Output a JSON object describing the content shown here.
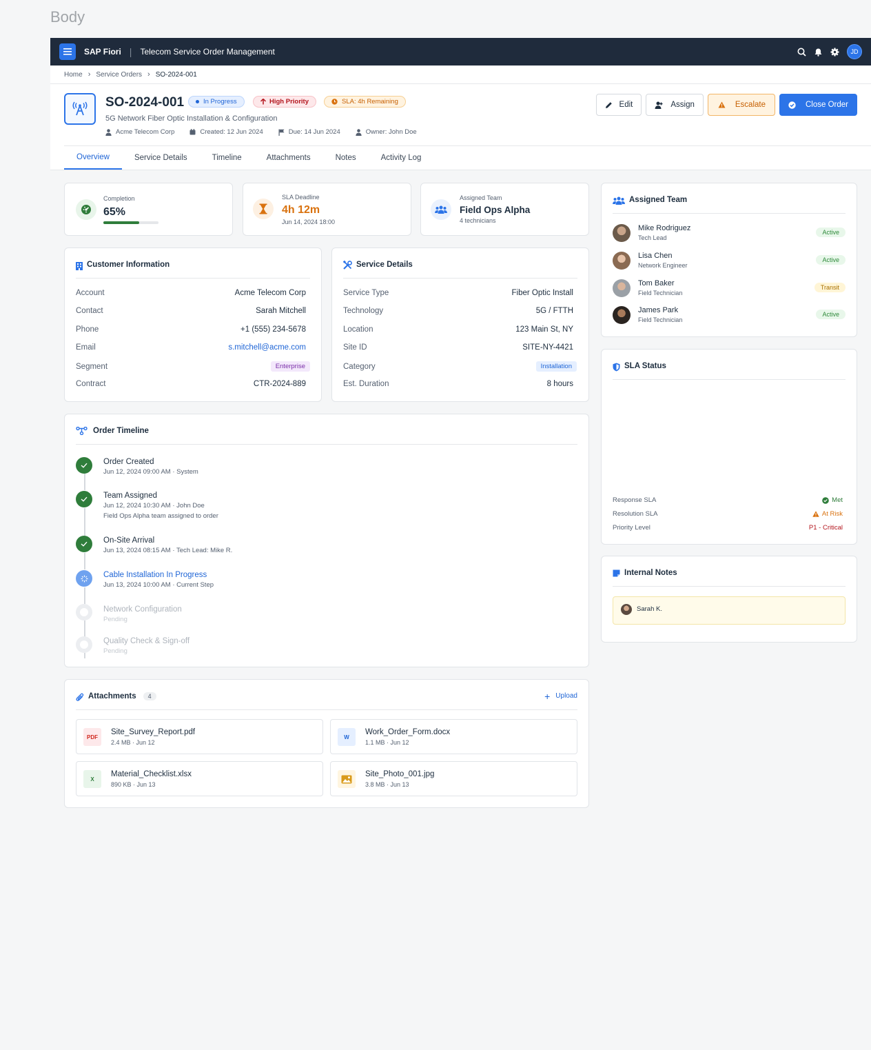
{
  "page_label": "Body",
  "shell": {
    "brand": "SAP Fiori",
    "title": "Telecom Service Order Management",
    "user_initials": "JD"
  },
  "breadcrumb": {
    "items": [
      "Home",
      "Service Orders"
    ],
    "current": "SO-2024-001"
  },
  "order": {
    "id": "SO-2024-001",
    "subtitle": "5G Network Fiber Optic Installation & Configuration",
    "badges": {
      "status": "In Progress",
      "priority": "High Priority",
      "sla": "SLA: 4h Remaining"
    },
    "meta": {
      "customer": "Acme Telecom Corp",
      "created": "Created: 12 Jun 2024",
      "due": "Due: 14 Jun 2024",
      "owner": "Owner: John Doe"
    }
  },
  "actions": {
    "edit": "Edit",
    "assign": "Assign",
    "escalate": "Escalate",
    "close": "Close Order"
  },
  "tabs": [
    "Overview",
    "Service Details",
    "Timeline",
    "Attachments",
    "Notes",
    "Activity Log"
  ],
  "kpis": {
    "completion": {
      "label": "Completion",
      "value": "65%",
      "progress": 0.65
    },
    "sla": {
      "label": "SLA Deadline",
      "value": "4h 12m",
      "sub": "Jun 14, 2024 18:00"
    },
    "team": {
      "label": "Assigned Team",
      "value": "Field Ops Alpha",
      "sub": "4 technicians"
    }
  },
  "customer": {
    "title": "Customer Information",
    "rows": [
      {
        "k": "Account",
        "v": "Acme Telecom Corp"
      },
      {
        "k": "Contact",
        "v": "Sarah Mitchell"
      },
      {
        "k": "Phone",
        "v": "+1 (555) 234-5678"
      },
      {
        "k": "Email",
        "v": "s.mitchell@acme.com"
      },
      {
        "k": "Segment",
        "v": "Enterprise"
      },
      {
        "k": "Contract",
        "v": "CTR-2024-889"
      }
    ]
  },
  "service": {
    "title": "Service Details",
    "rows": [
      {
        "k": "Service Type",
        "v": "Fiber Optic Install"
      },
      {
        "k": "Technology",
        "v": "5G / FTTH"
      },
      {
        "k": "Location",
        "v": "123 Main St, NY"
      },
      {
        "k": "Site ID",
        "v": "SITE-NY-4421"
      },
      {
        "k": "Category",
        "v": "Installation"
      },
      {
        "k": "Est. Duration",
        "v": "8 hours"
      }
    ]
  },
  "timeline": {
    "title": "Order Timeline",
    "items": [
      {
        "title": "Order Created",
        "sub": "Jun 12, 2024 09:00 AM · System",
        "note": ""
      },
      {
        "title": "Team Assigned",
        "sub": "Jun 12, 2024 10:30 AM · John Doe",
        "note": "Field Ops Alpha team assigned to order"
      },
      {
        "title": "On-Site Arrival",
        "sub": "Jun 13, 2024 08:15 AM · Tech Lead: Mike R.",
        "note": ""
      },
      {
        "title": "Cable Installation In Progress",
        "sub": "Jun 13, 2024 10:00 AM · Current Step",
        "note": ""
      },
      {
        "title": "Network Configuration",
        "sub": "Pending",
        "note": ""
      },
      {
        "title": "Quality Check & Sign-off",
        "sub": "Pending",
        "note": ""
      }
    ]
  },
  "attachments": {
    "title": "Attachments",
    "count": "4",
    "upload": "Upload",
    "files": [
      {
        "name": "Site_Survey_Report.pdf",
        "meta": "2.4 MB · Jun 12",
        "type": "PDF"
      },
      {
        "name": "Work_Order_Form.docx",
        "meta": "1.1 MB · Jun 12",
        "type": "W"
      },
      {
        "name": "Material_Checklist.xlsx",
        "meta": "890 KB · Jun 13",
        "type": "X"
      },
      {
        "name": "Site_Photo_001.jpg",
        "meta": "3.8 MB · Jun 13",
        "type": "IMG"
      }
    ]
  },
  "team": {
    "title": "Assigned Team",
    "members": [
      {
        "name": "Mike Rodriguez",
        "role": "Tech Lead",
        "status": "Active"
      },
      {
        "name": "Lisa Chen",
        "role": "Network Engineer",
        "status": "Active"
      },
      {
        "name": "Tom Baker",
        "role": "Field Technician",
        "status": "Transit"
      },
      {
        "name": "James Park",
        "role": "Field Technician",
        "status": "Active"
      }
    ]
  },
  "sla_status": {
    "title": "SLA Status",
    "rows": [
      {
        "k": "Response SLA",
        "v": "Met"
      },
      {
        "k": "Resolution SLA",
        "v": "At Risk"
      },
      {
        "k": "Priority Level",
        "v": "P1 - Critical"
      }
    ]
  },
  "notes": {
    "title": "Internal Notes",
    "author": "Sarah K."
  },
  "colors": {
    "accent": "#2c74e8",
    "shell": "#1f2b3c",
    "success": "#2f7d3b",
    "warning": "#d9720f",
    "critical": "#b3141c"
  }
}
